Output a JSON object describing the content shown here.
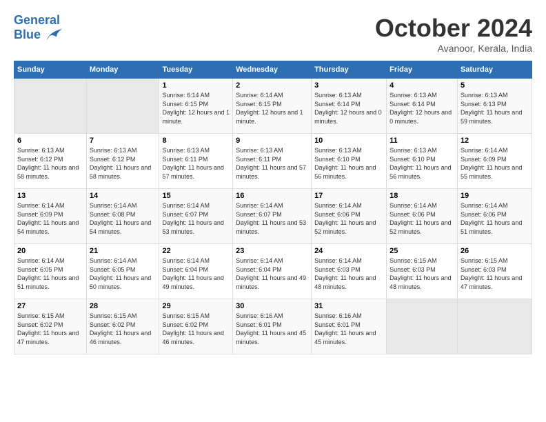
{
  "header": {
    "logo_line1": "General",
    "logo_line2": "Blue",
    "month": "October 2024",
    "location": "Avanoor, Kerala, India"
  },
  "weekdays": [
    "Sunday",
    "Monday",
    "Tuesday",
    "Wednesday",
    "Thursday",
    "Friday",
    "Saturday"
  ],
  "weeks": [
    [
      {
        "day": "",
        "sunrise": "",
        "sunset": "",
        "daylight": ""
      },
      {
        "day": "",
        "sunrise": "",
        "sunset": "",
        "daylight": ""
      },
      {
        "day": "1",
        "sunrise": "Sunrise: 6:14 AM",
        "sunset": "Sunset: 6:15 PM",
        "daylight": "Daylight: 12 hours and 1 minute."
      },
      {
        "day": "2",
        "sunrise": "Sunrise: 6:14 AM",
        "sunset": "Sunset: 6:15 PM",
        "daylight": "Daylight: 12 hours and 1 minute."
      },
      {
        "day": "3",
        "sunrise": "Sunrise: 6:13 AM",
        "sunset": "Sunset: 6:14 PM",
        "daylight": "Daylight: 12 hours and 0 minutes."
      },
      {
        "day": "4",
        "sunrise": "Sunrise: 6:13 AM",
        "sunset": "Sunset: 6:14 PM",
        "daylight": "Daylight: 12 hours and 0 minutes."
      },
      {
        "day": "5",
        "sunrise": "Sunrise: 6:13 AM",
        "sunset": "Sunset: 6:13 PM",
        "daylight": "Daylight: 11 hours and 59 minutes."
      }
    ],
    [
      {
        "day": "6",
        "sunrise": "Sunrise: 6:13 AM",
        "sunset": "Sunset: 6:12 PM",
        "daylight": "Daylight: 11 hours and 58 minutes."
      },
      {
        "day": "7",
        "sunrise": "Sunrise: 6:13 AM",
        "sunset": "Sunset: 6:12 PM",
        "daylight": "Daylight: 11 hours and 58 minutes."
      },
      {
        "day": "8",
        "sunrise": "Sunrise: 6:13 AM",
        "sunset": "Sunset: 6:11 PM",
        "daylight": "Daylight: 11 hours and 57 minutes."
      },
      {
        "day": "9",
        "sunrise": "Sunrise: 6:13 AM",
        "sunset": "Sunset: 6:11 PM",
        "daylight": "Daylight: 11 hours and 57 minutes."
      },
      {
        "day": "10",
        "sunrise": "Sunrise: 6:13 AM",
        "sunset": "Sunset: 6:10 PM",
        "daylight": "Daylight: 11 hours and 56 minutes."
      },
      {
        "day": "11",
        "sunrise": "Sunrise: 6:13 AM",
        "sunset": "Sunset: 6:10 PM",
        "daylight": "Daylight: 11 hours and 56 minutes."
      },
      {
        "day": "12",
        "sunrise": "Sunrise: 6:14 AM",
        "sunset": "Sunset: 6:09 PM",
        "daylight": "Daylight: 11 hours and 55 minutes."
      }
    ],
    [
      {
        "day": "13",
        "sunrise": "Sunrise: 6:14 AM",
        "sunset": "Sunset: 6:09 PM",
        "daylight": "Daylight: 11 hours and 54 minutes."
      },
      {
        "day": "14",
        "sunrise": "Sunrise: 6:14 AM",
        "sunset": "Sunset: 6:08 PM",
        "daylight": "Daylight: 11 hours and 54 minutes."
      },
      {
        "day": "15",
        "sunrise": "Sunrise: 6:14 AM",
        "sunset": "Sunset: 6:07 PM",
        "daylight": "Daylight: 11 hours and 53 minutes."
      },
      {
        "day": "16",
        "sunrise": "Sunrise: 6:14 AM",
        "sunset": "Sunset: 6:07 PM",
        "daylight": "Daylight: 11 hours and 53 minutes."
      },
      {
        "day": "17",
        "sunrise": "Sunrise: 6:14 AM",
        "sunset": "Sunset: 6:06 PM",
        "daylight": "Daylight: 11 hours and 52 minutes."
      },
      {
        "day": "18",
        "sunrise": "Sunrise: 6:14 AM",
        "sunset": "Sunset: 6:06 PM",
        "daylight": "Daylight: 11 hours and 52 minutes."
      },
      {
        "day": "19",
        "sunrise": "Sunrise: 6:14 AM",
        "sunset": "Sunset: 6:06 PM",
        "daylight": "Daylight: 11 hours and 51 minutes."
      }
    ],
    [
      {
        "day": "20",
        "sunrise": "Sunrise: 6:14 AM",
        "sunset": "Sunset: 6:05 PM",
        "daylight": "Daylight: 11 hours and 51 minutes."
      },
      {
        "day": "21",
        "sunrise": "Sunrise: 6:14 AM",
        "sunset": "Sunset: 6:05 PM",
        "daylight": "Daylight: 11 hours and 50 minutes."
      },
      {
        "day": "22",
        "sunrise": "Sunrise: 6:14 AM",
        "sunset": "Sunset: 6:04 PM",
        "daylight": "Daylight: 11 hours and 49 minutes."
      },
      {
        "day": "23",
        "sunrise": "Sunrise: 6:14 AM",
        "sunset": "Sunset: 6:04 PM",
        "daylight": "Daylight: 11 hours and 49 minutes."
      },
      {
        "day": "24",
        "sunrise": "Sunrise: 6:14 AM",
        "sunset": "Sunset: 6:03 PM",
        "daylight": "Daylight: 11 hours and 48 minutes."
      },
      {
        "day": "25",
        "sunrise": "Sunrise: 6:15 AM",
        "sunset": "Sunset: 6:03 PM",
        "daylight": "Daylight: 11 hours and 48 minutes."
      },
      {
        "day": "26",
        "sunrise": "Sunrise: 6:15 AM",
        "sunset": "Sunset: 6:03 PM",
        "daylight": "Daylight: 11 hours and 47 minutes."
      }
    ],
    [
      {
        "day": "27",
        "sunrise": "Sunrise: 6:15 AM",
        "sunset": "Sunset: 6:02 PM",
        "daylight": "Daylight: 11 hours and 47 minutes."
      },
      {
        "day": "28",
        "sunrise": "Sunrise: 6:15 AM",
        "sunset": "Sunset: 6:02 PM",
        "daylight": "Daylight: 11 hours and 46 minutes."
      },
      {
        "day": "29",
        "sunrise": "Sunrise: 6:15 AM",
        "sunset": "Sunset: 6:02 PM",
        "daylight": "Daylight: 11 hours and 46 minutes."
      },
      {
        "day": "30",
        "sunrise": "Sunrise: 6:16 AM",
        "sunset": "Sunset: 6:01 PM",
        "daylight": "Daylight: 11 hours and 45 minutes."
      },
      {
        "day": "31",
        "sunrise": "Sunrise: 6:16 AM",
        "sunset": "Sunset: 6:01 PM",
        "daylight": "Daylight: 11 hours and 45 minutes."
      },
      {
        "day": "",
        "sunrise": "",
        "sunset": "",
        "daylight": ""
      },
      {
        "day": "",
        "sunrise": "",
        "sunset": "",
        "daylight": ""
      }
    ]
  ]
}
